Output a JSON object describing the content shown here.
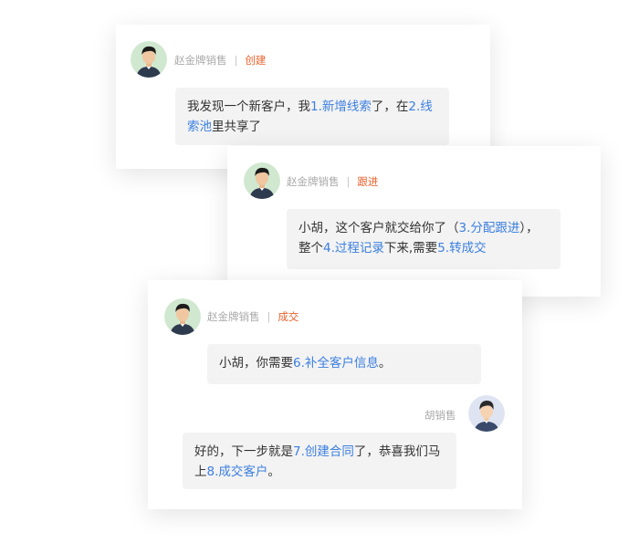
{
  "colors": {
    "link": "#3b7fe0",
    "stage": "#e8622c",
    "name": "#a8a8a8",
    "bubble": "#f3f3f3"
  },
  "cards": [
    {
      "sender": "赵金牌销售",
      "separator": "|",
      "stage": "创建",
      "avatar": "male-avatar-icon",
      "message": [
        "我发现一个新客户，我",
        "1.新增线索",
        "了，在",
        "2.线索池",
        "里共享了"
      ]
    },
    {
      "sender": "赵金牌销售",
      "separator": "|",
      "stage": "跟进",
      "avatar": "male-avatar-icon",
      "message": [
        "小胡，这个客户就交给你了（",
        "3.分配跟进",
        "），整个",
        "4.过程记录",
        "下来,需要",
        "5.转成交"
      ]
    },
    {
      "sender": "赵金牌销售",
      "separator": "|",
      "stage": "成交",
      "avatar": "male-avatar-icon",
      "message": [
        "小胡，你需要",
        "6.补全客户信息",
        "。"
      ],
      "reply": {
        "sender": "胡销售",
        "avatar": "female-avatar-icon",
        "message": [
          "好的，下一步就是",
          "7.创建合同",
          "了，恭喜我们马上",
          "8.成交客户",
          "。"
        ]
      }
    }
  ]
}
